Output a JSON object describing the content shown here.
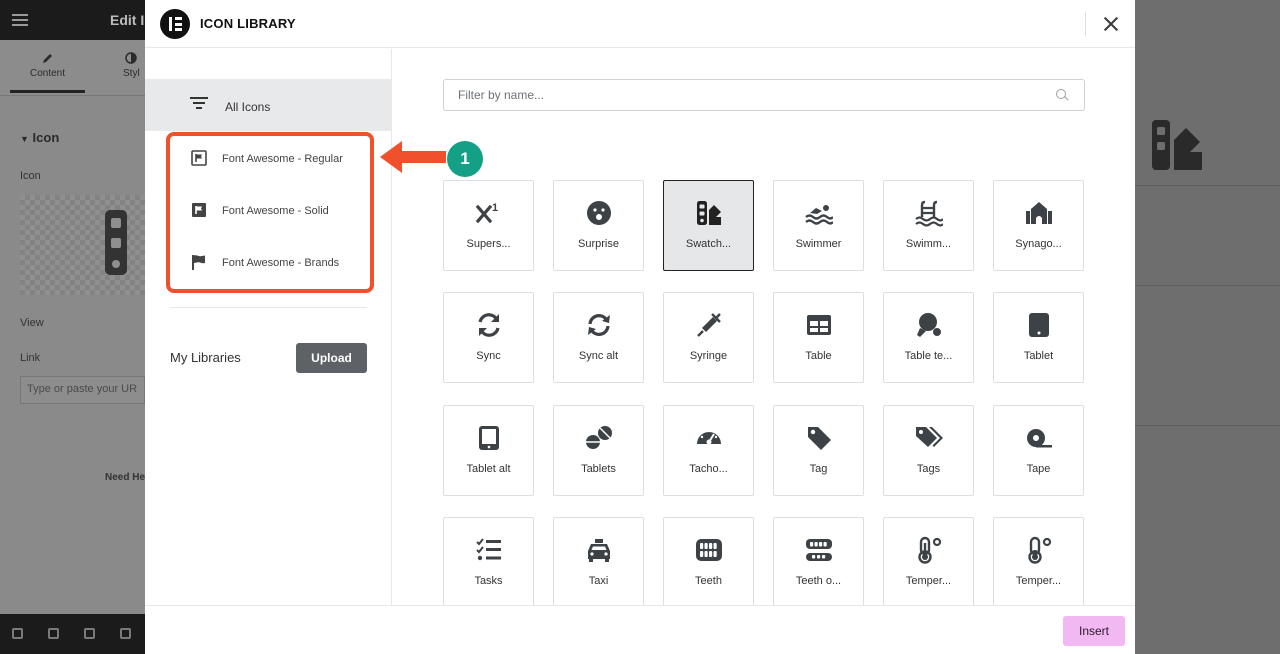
{
  "background_editor": {
    "title": "Edit I",
    "tabs": [
      {
        "label": "Content"
      },
      {
        "label": "Styl"
      }
    ],
    "section_title": "Icon",
    "icon_label": "Icon",
    "view_label": "View",
    "link_label": "Link",
    "link_placeholder": "Type or paste your UR",
    "help_text": "Need He"
  },
  "modal": {
    "title": "ICON LIBRARY",
    "sidebar": {
      "all_icons_label": "All Icons",
      "libraries": [
        {
          "label": "Font Awesome - Regular",
          "icon": "flag-regular-icon"
        },
        {
          "label": "Font Awesome - Solid",
          "icon": "flag-solid-icon"
        },
        {
          "label": "Font Awesome - Brands",
          "icon": "flag-brands-icon"
        }
      ],
      "my_libraries_label": "My Libraries",
      "upload_label": "Upload"
    },
    "search": {
      "placeholder": "Filter by name..."
    },
    "annotation": {
      "step_number": "1",
      "highlight_color": "#f0502b",
      "badge_color": "#14a086"
    },
    "icons": [
      {
        "label": "Supers...",
        "icon": "superscript-icon"
      },
      {
        "label": "Surprise",
        "icon": "surprise-icon"
      },
      {
        "label": "Swatch...",
        "icon": "swatchbook-icon",
        "selected": true
      },
      {
        "label": "Swimmer",
        "icon": "swimmer-icon"
      },
      {
        "label": "Swimm...",
        "icon": "swimming-pool-icon"
      },
      {
        "label": "Synago...",
        "icon": "synagogue-icon"
      },
      {
        "label": "Sync",
        "icon": "sync-icon"
      },
      {
        "label": "Sync alt",
        "icon": "sync-alt-icon"
      },
      {
        "label": "Syringe",
        "icon": "syringe-icon"
      },
      {
        "label": "Table",
        "icon": "table-icon"
      },
      {
        "label": "Table te...",
        "icon": "table-tennis-icon"
      },
      {
        "label": "Tablet",
        "icon": "tablet-icon"
      },
      {
        "label": "Tablet alt",
        "icon": "tablet-alt-icon"
      },
      {
        "label": "Tablets",
        "icon": "tablets-icon"
      },
      {
        "label": "Tacho...",
        "icon": "tachometer-icon"
      },
      {
        "label": "Tag",
        "icon": "tag-icon"
      },
      {
        "label": "Tags",
        "icon": "tags-icon"
      },
      {
        "label": "Tape",
        "icon": "tape-icon"
      },
      {
        "label": "Tasks",
        "icon": "tasks-icon"
      },
      {
        "label": "Taxi",
        "icon": "taxi-icon"
      },
      {
        "label": "Teeth",
        "icon": "teeth-icon"
      },
      {
        "label": "Teeth o...",
        "icon": "teeth-open-icon"
      },
      {
        "label": "Temper...",
        "icon": "temperature-high-icon"
      },
      {
        "label": "Temper...",
        "icon": "temperature-low-icon"
      }
    ],
    "insert_label": "Insert",
    "insert_color": "#f1b8f2"
  }
}
